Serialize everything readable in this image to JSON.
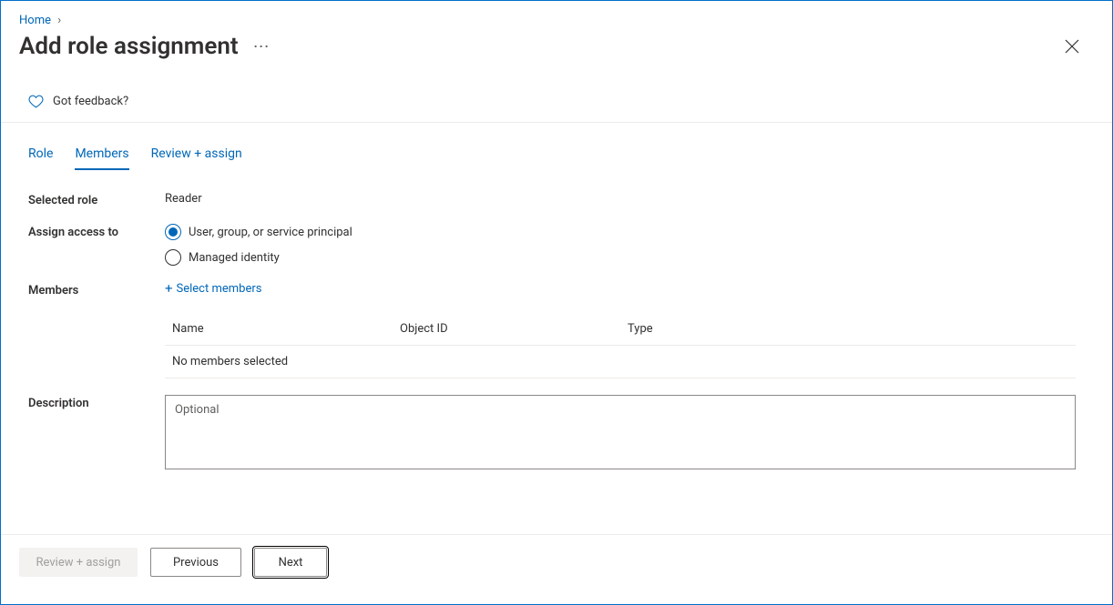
{
  "breadcrumb": {
    "home": "Home"
  },
  "title": "Add role assignment",
  "feedback_label": "Got feedback?",
  "tabs": {
    "role": "Role",
    "members": "Members",
    "review": "Review + assign"
  },
  "form": {
    "selected_role_label": "Selected role",
    "selected_role_value": "Reader",
    "assign_access_label": "Assign access to",
    "radio_user": "User, group, or service principal",
    "radio_managed": "Managed identity",
    "members_label": "Members",
    "select_members_link": "Select members",
    "table": {
      "col_name": "Name",
      "col_objid": "Object ID",
      "col_type": "Type",
      "empty": "No members selected"
    },
    "description_label": "Description",
    "description_placeholder": "Optional",
    "description_value": ""
  },
  "footer": {
    "review_assign": "Review + assign",
    "previous": "Previous",
    "next": "Next"
  }
}
